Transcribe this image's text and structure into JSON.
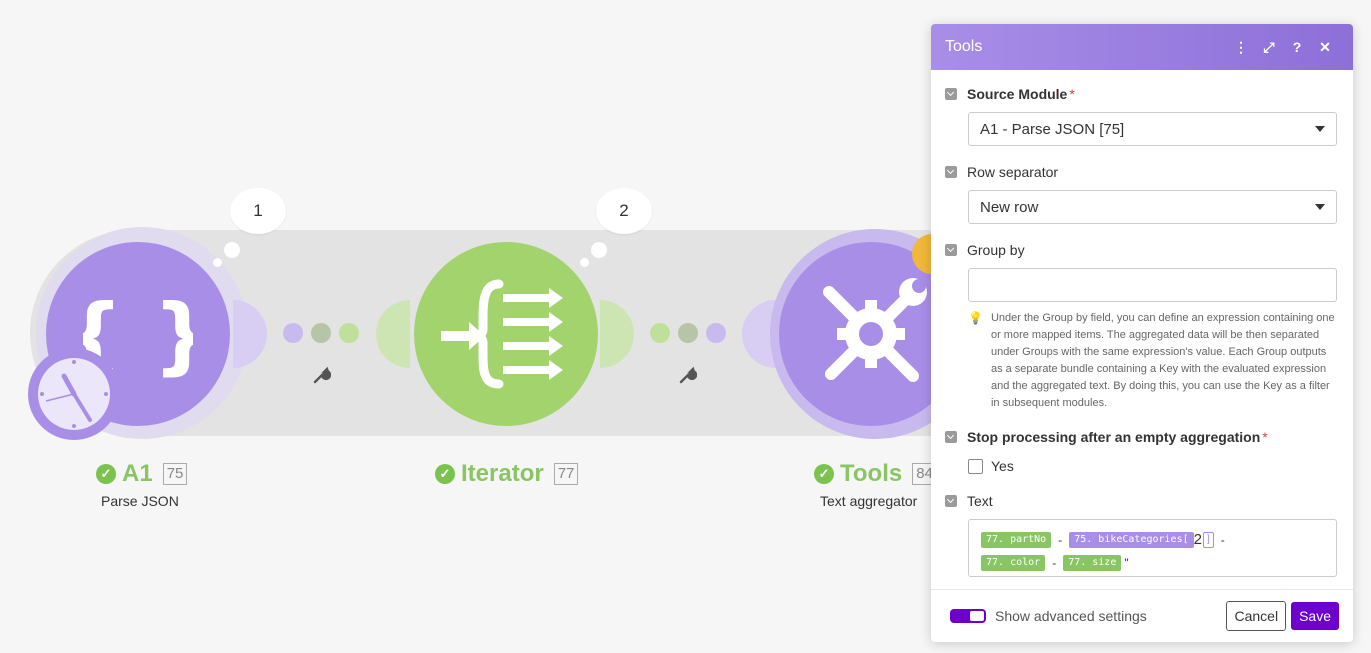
{
  "modules": [
    {
      "name": "A1",
      "id": "75",
      "subtitle": "Parse JSON",
      "counter": "1",
      "glyph": "{ }",
      "icon": "json-braces-icon"
    },
    {
      "name": "Iterator",
      "id": "77",
      "subtitle": "",
      "counter": "2",
      "icon": "iterator-icon"
    },
    {
      "name": "Tools",
      "id": "84",
      "subtitle": "Text aggregator",
      "icon": "tools-icon"
    }
  ],
  "colors": {
    "purple": "#a98ee8",
    "green": "#a3d36d",
    "accent": "#6d00cc"
  },
  "panel": {
    "title": "Tools",
    "fields": {
      "source_module": {
        "label": "Source Module",
        "required": "*",
        "value": "A1 - Parse JSON [75]"
      },
      "row_separator": {
        "label": "Row separator",
        "value": "New row"
      },
      "group_by": {
        "label": "Group by",
        "value": "",
        "help": "Under the Group by field, you can define an expression containing one or more mapped items. The aggregated data will be then separated under Groups with the same expression's value. Each Group outputs as a separate bundle containing a Key with the evaluated expression and the aggregated text. By doing this, you can use the Key as a filter in subsequent modules."
      },
      "stop_processing": {
        "label": "Stop processing after an empty aggregation",
        "required": "*",
        "option": "Yes"
      },
      "text": {
        "label": "Text",
        "tokens": {
          "t1": "77. partNo",
          "sep1": "-",
          "t2": "75. bikeCategories[",
          "idx": "2",
          "bracket": "]",
          "sep2": "-",
          "t3": "77. color",
          "sep3": "-",
          "t4": "77. size",
          "tail": "\""
        }
      }
    },
    "footer": {
      "advanced_label": "Show advanced settings",
      "cancel": "Cancel",
      "save": "Save"
    }
  }
}
